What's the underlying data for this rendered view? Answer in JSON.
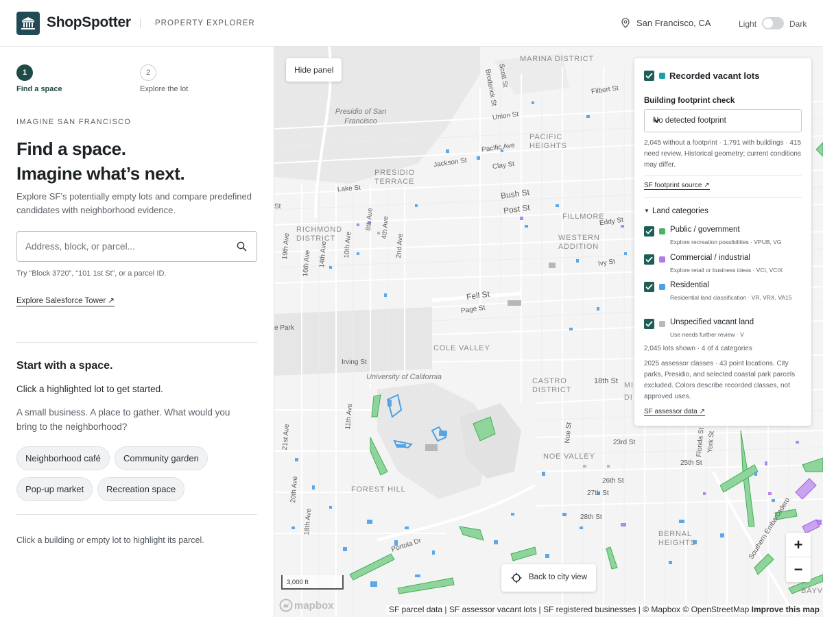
{
  "header": {
    "brand": "ShopSpotter",
    "subtitle": "PROPERTY EXPLORER",
    "location": "San Francisco, CA",
    "theme_light": "Light",
    "theme_dark": "Dark"
  },
  "steps": [
    {
      "number": "1",
      "label": "Find a space"
    },
    {
      "number": "2",
      "label": "Explore the lot"
    }
  ],
  "sidebar": {
    "eyebrow": "IMAGINE SAN FRANCISCO",
    "headline_1": "Find a space.",
    "headline_2": "Imagine what’s next.",
    "intro": "Explore SF’s potentially empty lots and compare predefined candidates with neighborhood evidence.",
    "search_placeholder": "Address, block, or parcel...",
    "search_hint": "Try “Block 3720”, “101 1st St”, or a parcel ID.",
    "explore_link": "Explore Salesforce Tower ↗",
    "start_heading": "Start with a space.",
    "click_lot": "Click a highlighted lot to get started.",
    "question": "A small business. A place to gather. What would you bring to the neighborhood?",
    "chips": [
      "Neighborhood café",
      "Community garden",
      "Pop-up market",
      "Recreation space"
    ],
    "footer": "Click a building or empty lot to highlight its parcel."
  },
  "map": {
    "hide_panel": "Hide panel",
    "back_to_city": "Back to city view",
    "scale": "3,000 ft",
    "mapbox_logo": "mapbox",
    "zoom_in": "+",
    "zoom_out": "−",
    "attribution": "SF parcel data | SF assessor vacant lots | SF registered businesses | © Mapbox © OpenStreetMap",
    "improve": "Improve this map",
    "neighborhoods": [
      "MARINA DISTRICT",
      "PACIFIC HEIGHTS",
      "PRESIDIO TERRACE",
      "RICHMOND DISTRICT",
      "FILLMORE",
      "WESTERN ADDITION",
      "COLE VALLEY",
      "CASTRO DISTRICT",
      "NOE VALLEY",
      "FOREST HILL",
      "BERNAL HEIGHTS",
      "BAYVIEW",
      "MI",
      "DI"
    ],
    "parks": [
      "Presidio of San Francisco",
      "University of California"
    ],
    "streets": [
      "Scott St",
      "Broderick St",
      "Union St",
      "Filbert St",
      "Pacific Ave",
      "Jackson St",
      "Clay St",
      "Bush St",
      "Post St",
      "Lake St",
      "Eddy St",
      "Ivy St",
      "Fell St",
      "Page St",
      "Irving St",
      "18th St",
      "23rd St",
      "25th St",
      "26th St",
      "27th St",
      "28th St",
      "Portola Dr",
      "8th Ave",
      "4th Ave",
      "2nd Ave",
      "10th Ave",
      "14th Ave",
      "16th Ave",
      "19th Ave",
      "11th Ave",
      "21st Ave",
      "20th Ave",
      "18th Ave",
      "Noe St",
      "Florida St",
      "York St",
      "Southern Embarcadero",
      "St",
      "e Park"
    ]
  },
  "panel": {
    "vacant_title": "Recorded vacant lots",
    "footprint_label": "Building footprint check",
    "footprint_value": "No detected footprint",
    "footprint_stats": "2,045 without a footprint · 1,791 with buildings · 415 need review. Historical geometry; current conditions may differ.",
    "footprint_link": "SF footprint source ↗",
    "land_title": "Land categories",
    "categories": [
      {
        "name": "Public / government",
        "desc": "Explore recreation possibilities · VPUB, VG",
        "color": "#4caf6a"
      },
      {
        "name": "Commercial / industrial",
        "desc": "Explore retail or business ideas · VCI, VCIX",
        "color": "#b27be6"
      },
      {
        "name": "Residential",
        "desc": "Residential land classification · VR, VRX, VA15",
        "color": "#4b9fe6"
      },
      {
        "name": "Unspecified vacant land",
        "desc": "Use needs further review · V",
        "color": "#b8babd"
      }
    ],
    "lots_shown": "2,045 lots shown · 4 of 4 categories",
    "assessor_note": "2025 assessor classes · 43 point locations. City parks, Presidio, and selected coastal park parcels excluded. Colors describe recorded classes, not approved uses.",
    "assessor_link": "SF assessor data ↗"
  },
  "colors": {
    "brand": "#1f4a56",
    "accent": "#1f5d57",
    "vacant_swatch": "#1aa3a0",
    "public": "#4caf6a",
    "commercial": "#b27be6",
    "residential": "#4b9fe6",
    "unspecified": "#b8babd"
  }
}
